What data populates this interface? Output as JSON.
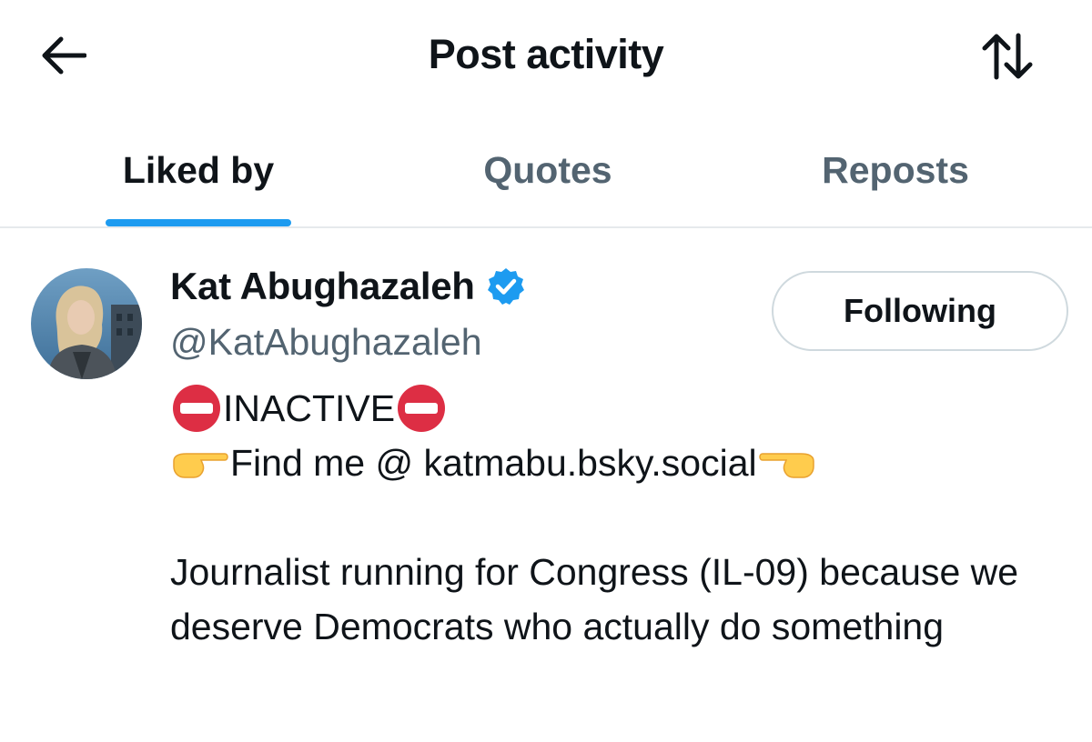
{
  "header": {
    "title": "Post activity",
    "back_icon": "arrow-left-icon",
    "sort_icon": "sort-arrows-icon"
  },
  "tabs": [
    {
      "label": "Liked by",
      "active": true
    },
    {
      "label": "Quotes",
      "active": false
    },
    {
      "label": "Reposts",
      "active": false
    }
  ],
  "user": {
    "display_name": "Kat Abughazaleh",
    "verified": true,
    "handle": "@KatAbughazaleh",
    "follow_button_label": "Following",
    "bio": {
      "line1_text": "INACTIVE",
      "line2_text": "Find me @ katmabu.bsky.social",
      "paragraph": "Journalist running for Congress (IL-09) because we deserve Democrats who actually do something"
    }
  },
  "colors": {
    "accent": "#1d9bf0",
    "text_primary": "#0f1419",
    "text_secondary": "#536471",
    "border": "#cfd9de"
  }
}
